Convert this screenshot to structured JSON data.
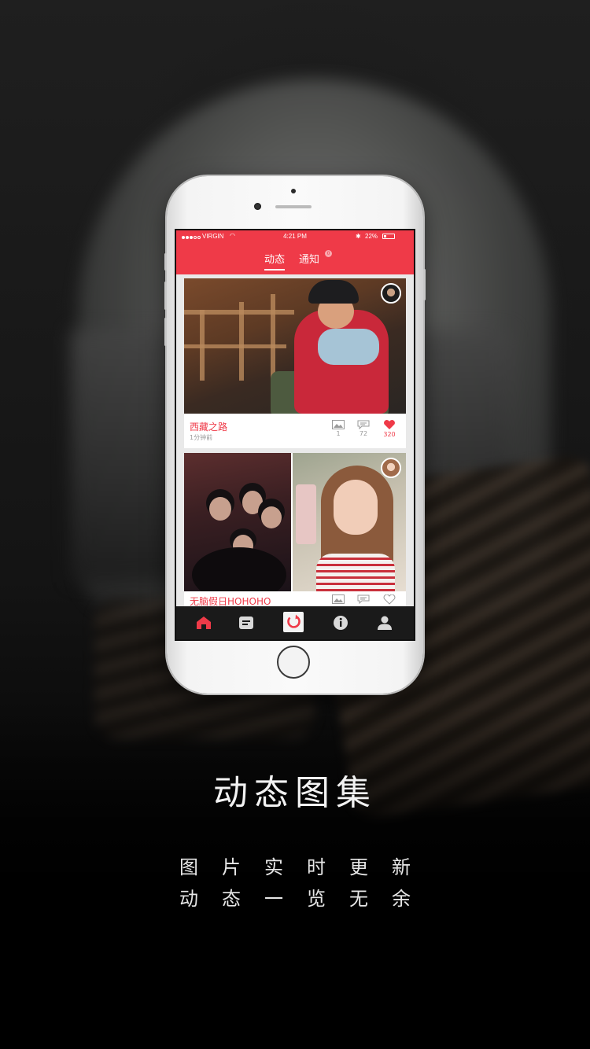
{
  "status_bar": {
    "carrier": "VIRGIN",
    "time": "4:21 PM",
    "battery_percent": "22%"
  },
  "header": {
    "tabs": [
      {
        "label": "动态",
        "active": true
      },
      {
        "label": "通知",
        "active": false
      }
    ],
    "notification_badge": "0"
  },
  "feed": {
    "posts": [
      {
        "title": "西藏之路",
        "time": "1分钟前",
        "images_count": "1",
        "comments_count": "72",
        "likes_count": "320",
        "liked": true
      },
      {
        "title": "无脑假日HOHOHO"
      }
    ]
  },
  "tabbar": {
    "icons": [
      "home-icon",
      "feed-icon",
      "refresh-icon",
      "info-icon",
      "profile-icon"
    ],
    "active": "home-icon"
  },
  "promo": {
    "headline": "动态图集",
    "line1": "图片实时更新",
    "line2": "动态一览无余"
  },
  "colors": {
    "accent": "#ef3a48",
    "tabbar": "#1a1a1a"
  }
}
